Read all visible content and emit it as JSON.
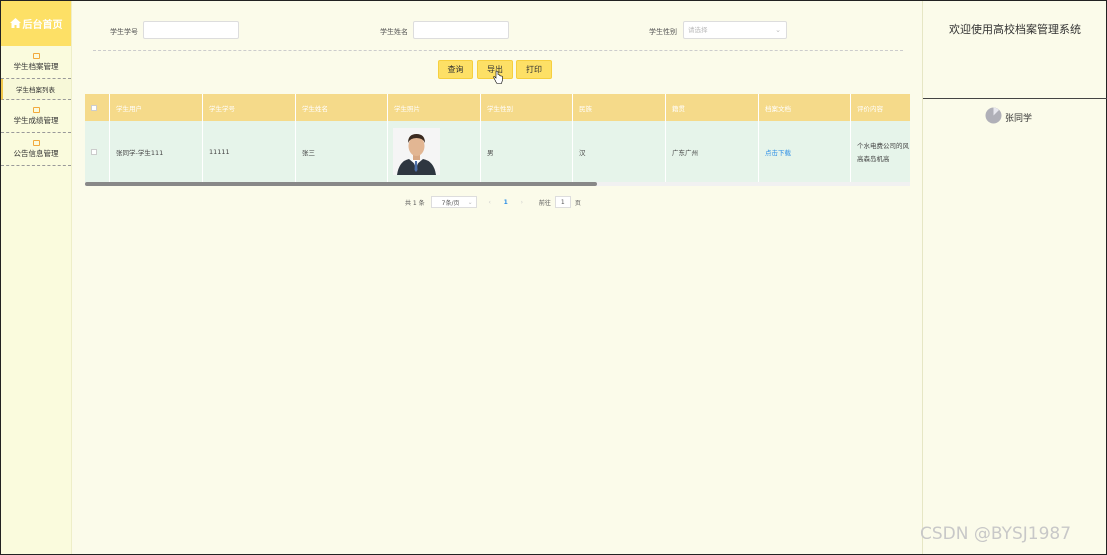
{
  "sidebar": {
    "home": "后台首页",
    "groups": [
      {
        "label": "学生档案管理",
        "sub": [
          "学生档案列表"
        ]
      },
      {
        "label": "学生成绩管理"
      },
      {
        "label": "公告信息管理"
      }
    ]
  },
  "search": {
    "student_no_label": "学生学号",
    "student_name_label": "学生姓名",
    "gender_label": "学生性别",
    "gender_placeholder": "请选择"
  },
  "buttons": {
    "query": "查询",
    "export": "导出",
    "print": "打印"
  },
  "table": {
    "headers": [
      "学生用户",
      "学生学号",
      "学生姓名",
      "学生照片",
      "学生性别",
      "民族",
      "籍贯",
      "档案文档",
      "评价内容"
    ],
    "rows": [
      {
        "user": "张同学-学生111",
        "student_no": "11111",
        "name": "张三",
        "gender": "男",
        "ethnicity": "汉",
        "hometown": "广东广州",
        "document": "点击下载",
        "evaluation_line1": "个水电费公司的风",
        "evaluation_line2": "高森岛机高"
      }
    ]
  },
  "pagination": {
    "total": "共 1 条",
    "page_size": "7条/页",
    "current": "1",
    "goto_label": "前往",
    "goto_value": "1",
    "page_suffix": "页"
  },
  "right": {
    "welcome": "欢迎使用高校档案管理系统",
    "username": "张同学"
  },
  "watermark": "CSDN @BYSJ1987",
  "colors": {
    "accent": "#fde066",
    "header": "#f5da8a",
    "row": "#e6f4ea",
    "link": "#2e8fe6"
  }
}
